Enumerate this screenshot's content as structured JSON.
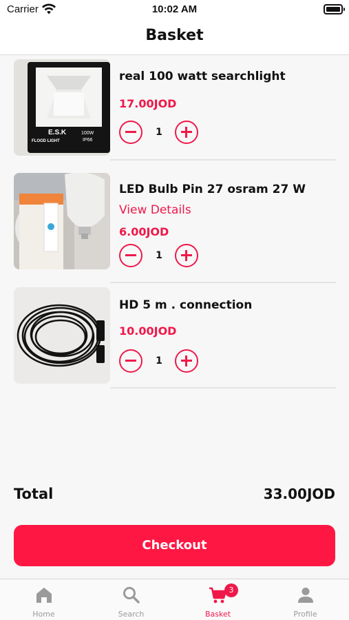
{
  "status_bar": {
    "carrier": "Carrier",
    "time": "10:02 AM"
  },
  "header": {
    "title": "Basket"
  },
  "items": [
    {
      "name": "real 100 watt searchlight",
      "price": "17.00JOD",
      "quantity": "1",
      "image_text": {
        "brand": "E.S.K",
        "line": "FLOOD LIGHT",
        "watt": "100W",
        "ip": "IP66"
      }
    },
    {
      "name": "LED Bulb Pin 27 osram 27 W",
      "details_link": "View Details",
      "price": "6.00JOD",
      "quantity": "1"
    },
    {
      "name": "HD 5 m . connection",
      "price": "10.00JOD",
      "quantity": "1"
    }
  ],
  "summary": {
    "total_label": "Total",
    "total_value": "33.00JOD"
  },
  "checkout": {
    "label": "Checkout"
  },
  "tab_bar": {
    "tabs": [
      {
        "label": "Home",
        "icon": "home-icon"
      },
      {
        "label": "Search",
        "icon": "search-icon"
      },
      {
        "label": "Basket",
        "icon": "cart-icon",
        "badge": "3",
        "active": true
      },
      {
        "label": "Profile",
        "icon": "person-icon"
      }
    ]
  },
  "colors": {
    "accent": "#f0184a",
    "checkout": "#ff1744",
    "inactive_tab": "#9a9a9a"
  }
}
